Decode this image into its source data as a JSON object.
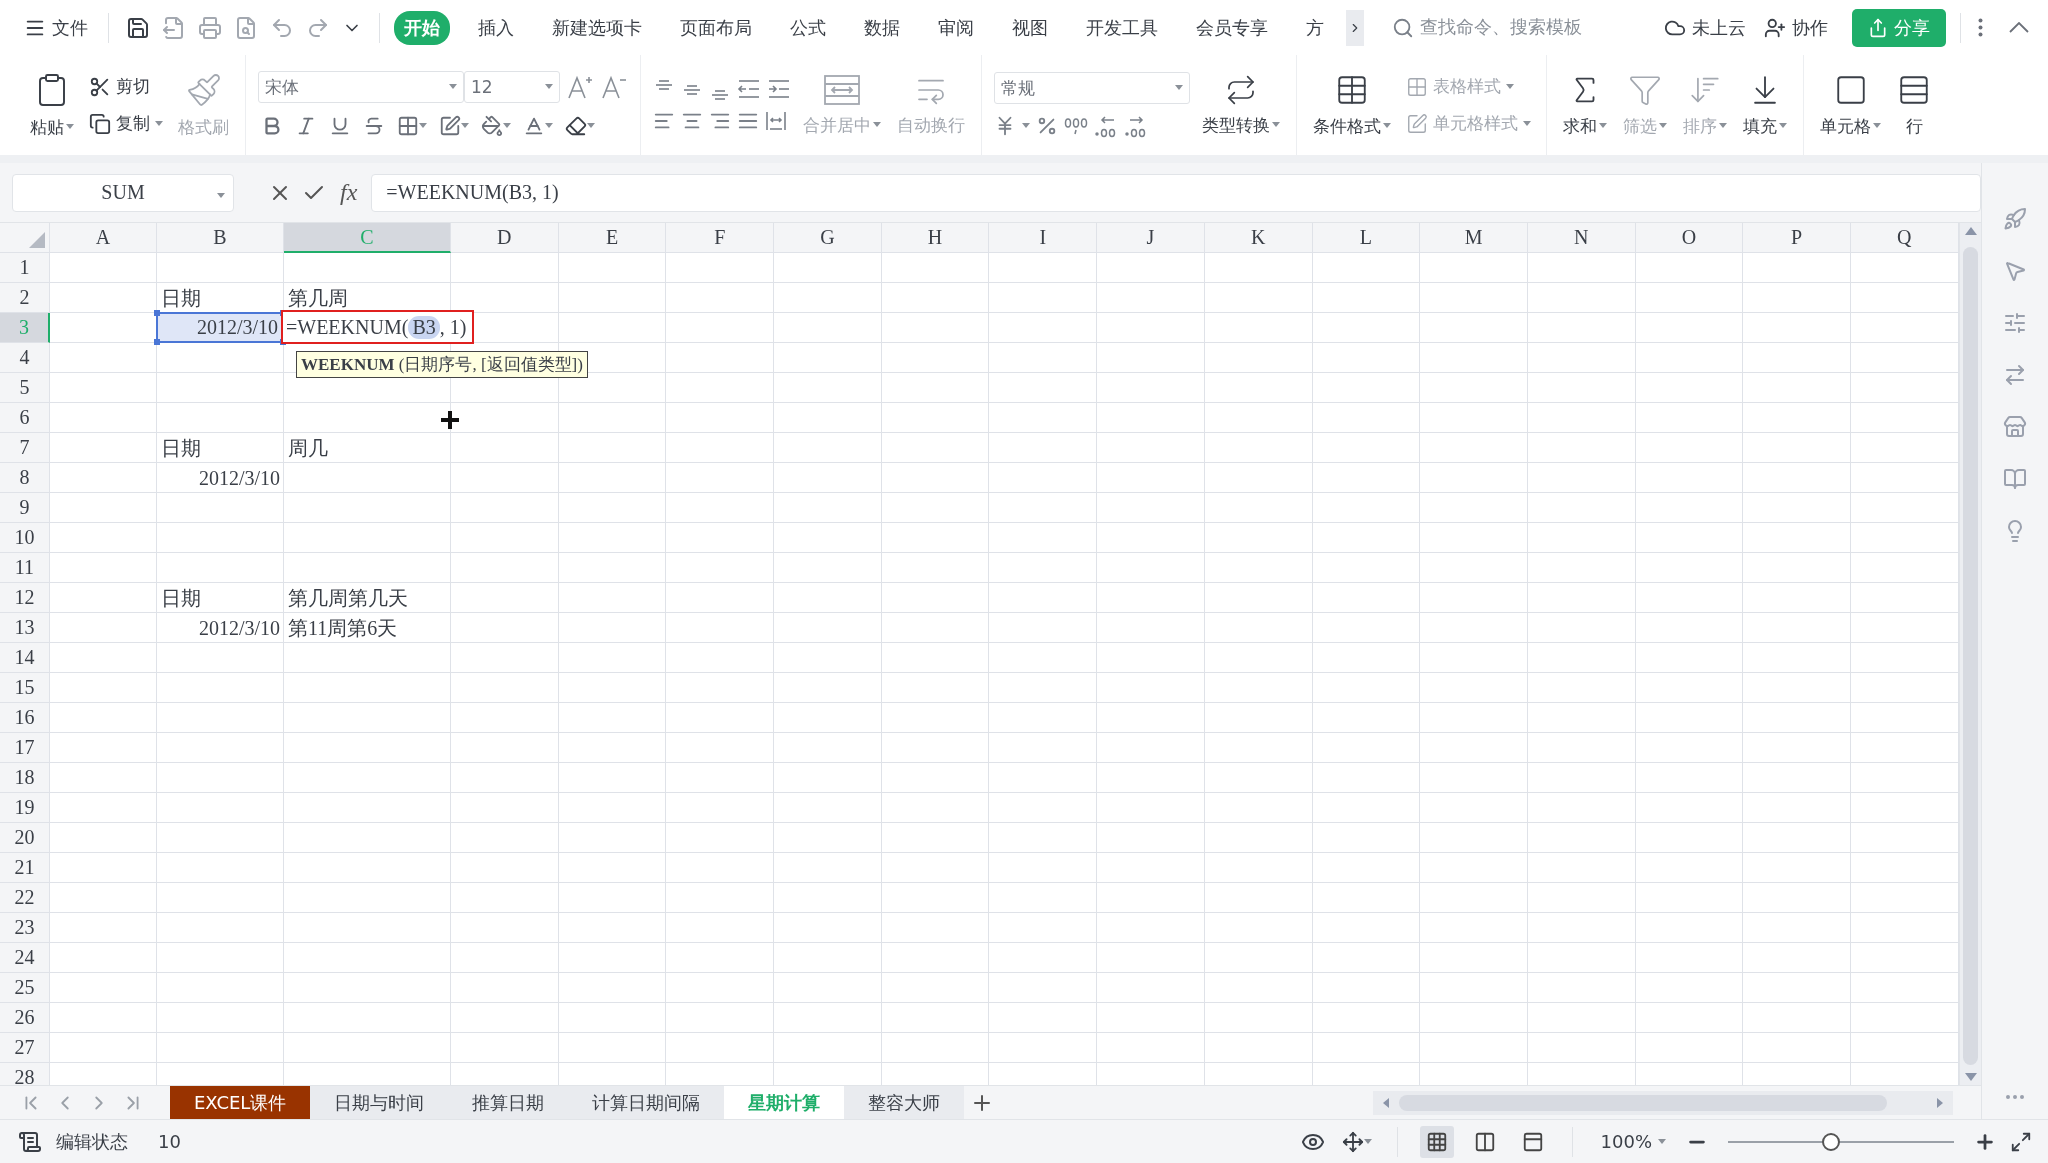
{
  "title_bar": {
    "file_menu": "文件",
    "tabs": [
      {
        "label": "开始",
        "selected": true
      },
      {
        "label": "插入",
        "selected": false
      },
      {
        "label": "新建选项卡",
        "selected": false
      },
      {
        "label": "页面布局",
        "selected": false
      },
      {
        "label": "公式",
        "selected": false
      },
      {
        "label": "数据",
        "selected": false
      },
      {
        "label": "审阅",
        "selected": false
      },
      {
        "label": "视图",
        "selected": false
      },
      {
        "label": "开发工具",
        "selected": false
      },
      {
        "label": "会员专享",
        "selected": false
      },
      {
        "label": "方",
        "selected": false
      }
    ],
    "search": {
      "placeholder": "查找命令、搜索模板"
    },
    "cloud_status": "未上云",
    "collaborate": "协作",
    "share": "分享"
  },
  "ribbon": {
    "clipboard": {
      "paste": "粘贴",
      "cut": "剪切",
      "copy": "复制",
      "format_painter": {
        "label": "格式刷",
        "disabled": true
      }
    },
    "font": {
      "name": "宋体",
      "size": "12"
    },
    "alignment": {
      "merge": {
        "label": "合并居中",
        "disabled": true
      },
      "wrap": {
        "label": "自动换行",
        "disabled": true
      }
    },
    "number": {
      "format": "常规",
      "convert": "类型转换"
    },
    "styles": [
      {
        "kind": "conditional",
        "label": "条件格式",
        "disabled": false
      },
      {
        "kind": "table",
        "label": "表格样式",
        "disabled": true
      },
      {
        "kind": "cell",
        "label": "单元格样式",
        "disabled": true
      }
    ],
    "editing": [
      {
        "kind": "sum",
        "label": "求和",
        "disabled": false
      },
      {
        "kind": "filter",
        "label": "筛选",
        "disabled": true
      },
      {
        "kind": "sort",
        "label": "排序",
        "disabled": true
      },
      {
        "kind": "fill",
        "label": "填充",
        "disabled": false
      }
    ],
    "cells": [
      {
        "kind": "cell",
        "label": "单元格"
      },
      {
        "kind": "rows",
        "label": "行"
      }
    ]
  },
  "formula_bar": {
    "name_box": "SUM",
    "function_button": "fx",
    "formula": "=WEEKNUM(B3, 1)"
  },
  "sheet": {
    "columns": [
      {
        "label": "A",
        "selected": false
      },
      {
        "label": "B",
        "selected": false
      },
      {
        "label": "C",
        "selected": true
      },
      {
        "label": "D",
        "selected": false
      },
      {
        "label": "E",
        "selected": false
      },
      {
        "label": "F",
        "selected": false
      },
      {
        "label": "G",
        "selected": false
      },
      {
        "label": "H",
        "selected": false
      },
      {
        "label": "I",
        "selected": false
      },
      {
        "label": "J",
        "selected": false
      },
      {
        "label": "K",
        "selected": false
      },
      {
        "label": "L",
        "selected": false
      },
      {
        "label": "M",
        "selected": false
      },
      {
        "label": "N",
        "selected": false
      },
      {
        "label": "O",
        "selected": false
      },
      {
        "label": "P",
        "selected": false
      },
      {
        "label": "Q",
        "selected": false
      }
    ],
    "rows": [
      {
        "label": "1",
        "selected": false
      },
      {
        "label": "2",
        "selected": false,
        "b": {
          "kind": "text",
          "text": "日期"
        },
        "c": {
          "kind": "text",
          "text": "第几周"
        }
      },
      {
        "label": "3",
        "selected": true,
        "b": {
          "kind": "number",
          "text": "2012/3/10",
          "referenced": true
        },
        "c": {
          "kind": "editor",
          "before": "=WEEKNUM(",
          "reference": "B3",
          "after": ", 1)",
          "tip": "**WEEKNUM** (日期序号, [返回值类型])"
        }
      },
      {
        "label": "4",
        "selected": false
      },
      {
        "label": "5",
        "selected": false
      },
      {
        "label": "6",
        "selected": false
      },
      {
        "label": "7",
        "selected": false,
        "b": {
          "kind": "text",
          "text": "日期"
        },
        "c": {
          "kind": "text",
          "text": "周几"
        }
      },
      {
        "label": "8",
        "selected": false,
        "b": {
          "kind": "number",
          "text": "2012/3/10"
        }
      },
      {
        "label": "9",
        "selected": false
      },
      {
        "label": "10",
        "selected": false
      },
      {
        "label": "11",
        "selected": false
      },
      {
        "label": "12",
        "selected": false,
        "b": {
          "kind": "text",
          "text": "日期"
        },
        "c": {
          "kind": "text",
          "text": "第几周第几天"
        }
      },
      {
        "label": "13",
        "selected": false,
        "b": {
          "kind": "number",
          "text": "2012/3/10"
        },
        "c": {
          "kind": "text",
          "text": "第11周第6天"
        }
      },
      {
        "label": "14",
        "selected": false
      },
      {
        "label": "15",
        "selected": false
      },
      {
        "label": "16",
        "selected": false
      },
      {
        "label": "17",
        "selected": false
      },
      {
        "label": "18",
        "selected": false
      },
      {
        "label": "19",
        "selected": false
      },
      {
        "label": "20",
        "selected": false
      },
      {
        "label": "21",
        "selected": false
      },
      {
        "label": "22",
        "selected": false
      },
      {
        "label": "23",
        "selected": false
      },
      {
        "label": "24",
        "selected": false
      },
      {
        "label": "25",
        "selected": false
      },
      {
        "label": "26",
        "selected": false
      },
      {
        "label": "27",
        "selected": false
      },
      {
        "label": "28",
        "selected": false
      }
    ]
  },
  "sheet_tabs": [
    {
      "label": "EXCEL课件",
      "selected": false,
      "color": "#993300"
    },
    {
      "label": "日期与时间",
      "selected": false
    },
    {
      "label": "推算日期",
      "selected": false
    },
    {
      "label": "计算日期间隔",
      "selected": false
    },
    {
      "label": "星期计算",
      "selected": true
    },
    {
      "label": "整容大师",
      "selected": false
    }
  ],
  "status_bar": {
    "mode": "编辑状态",
    "value": "10",
    "views": [
      {
        "kind": "normal",
        "selected": true
      },
      {
        "kind": "page",
        "selected": false
      },
      {
        "kind": "break",
        "selected": false
      }
    ],
    "zoom": "100%",
    "zoom_slider": {
      "level": 0.45
    }
  }
}
